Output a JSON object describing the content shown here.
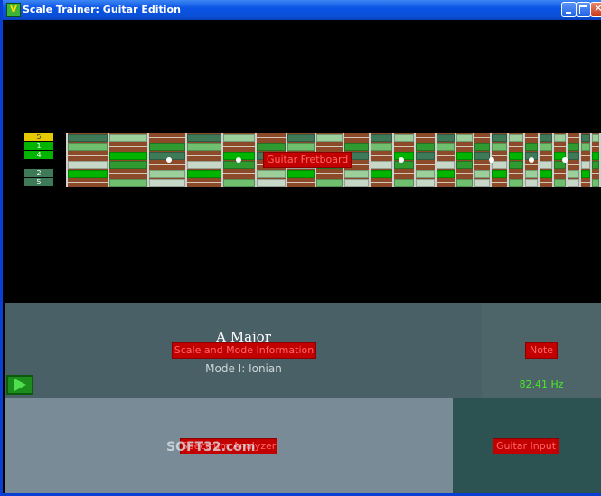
{
  "window": {
    "title": "Scale Trainer: Guitar Edition"
  },
  "fretboard": {
    "label": "Guitar Fretboard",
    "legend": [
      "5",
      "1",
      "4",
      "",
      "2",
      "5"
    ],
    "legend_colors": [
      "#e6c800",
      "#00b400",
      "#00b400",
      "",
      "#3f7a58",
      "#3f7a58"
    ]
  },
  "scale_panel": {
    "label": "Scale and Mode Information",
    "title": "A Major",
    "mode": "Mode I: Ionian"
  },
  "note_panel": {
    "label": "Note",
    "frequency": "82.41 Hz"
  },
  "spectrum_panel": {
    "label": "Spectrum Analyzer",
    "watermark": "SOFT32.com"
  },
  "input_panel": {
    "label": "Guitar Input"
  },
  "icons": {
    "app": "app-icon",
    "play": "play-icon"
  }
}
